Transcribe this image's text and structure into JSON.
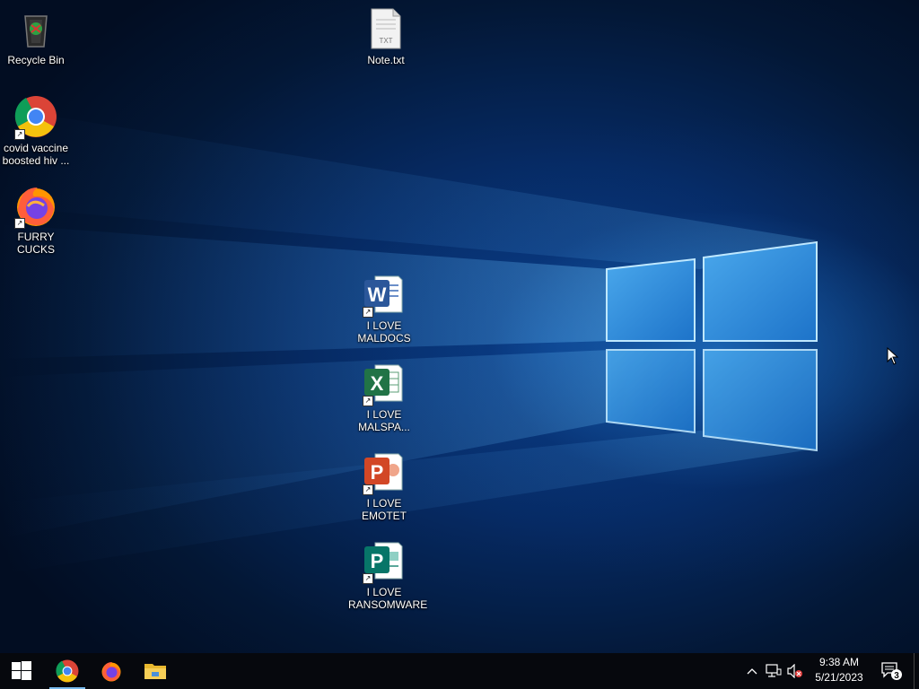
{
  "desktop_icons": [
    {
      "label": "Recycle Bin",
      "icon": "recycle-bin-icon"
    },
    {
      "label": "Note.txt",
      "icon": "text-file-icon",
      "badge": "TXT"
    },
    {
      "label": "covid vaccine boosted hiv ...",
      "icon": "chrome-icon"
    },
    {
      "label": "FURRY CUCKS",
      "icon": "firefox-icon"
    },
    {
      "label": "I LOVE MALDOCS",
      "icon": "word-icon",
      "letter": "W"
    },
    {
      "label": "I LOVE MALSPA...",
      "icon": "excel-icon",
      "letter": "X"
    },
    {
      "label": "I LOVE EMOTET",
      "icon": "powerpoint-icon",
      "letter": "P"
    },
    {
      "label": "I LOVE RANSOMWARE",
      "icon": "publisher-icon",
      "letter": "P"
    }
  ],
  "taskbar": {
    "pinned": [
      "start-icon",
      "chrome-icon",
      "firefox-icon",
      "file-explorer-icon"
    ],
    "clock": {
      "time": "9:38 AM",
      "date": "5/21/2023"
    },
    "notifications": {
      "count": "3"
    }
  },
  "colors": {
    "taskbar": "#06080d",
    "accent": "#76b9ed",
    "chrome_red": "#db4437",
    "chrome_yellow": "#f4c20d",
    "chrome_green": "#0f9d58",
    "chrome_blue": "#4285f4",
    "word": "#2b579a",
    "excel": "#217346",
    "powerpoint": "#d24726",
    "publisher": "#077568"
  }
}
